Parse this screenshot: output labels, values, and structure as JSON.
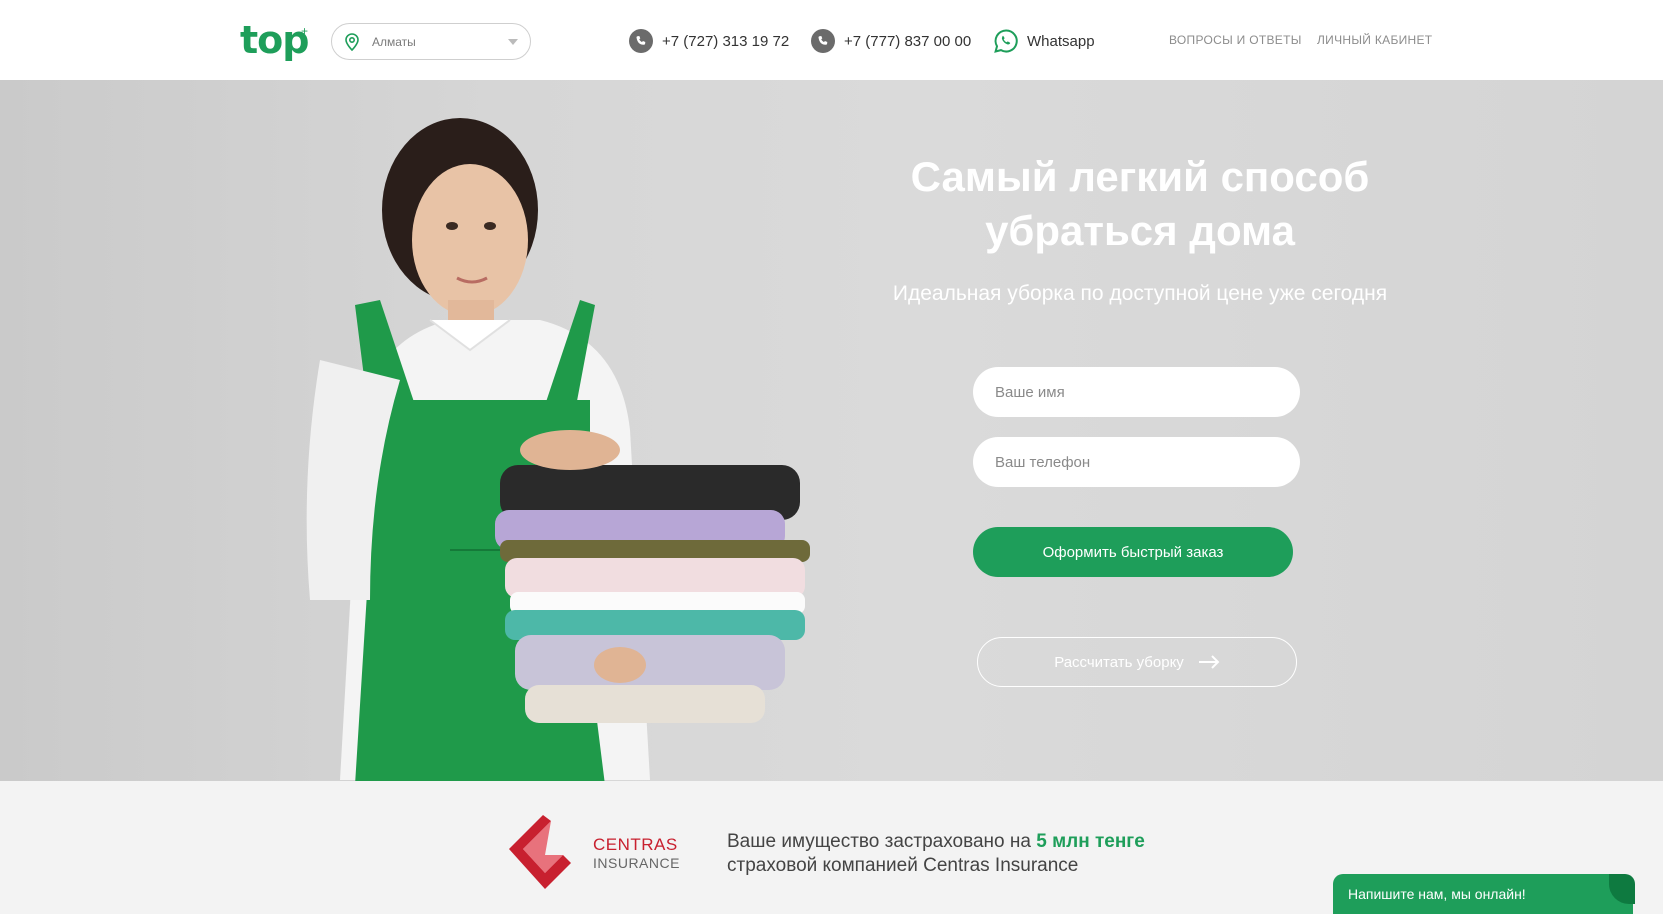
{
  "header": {
    "logo": "top",
    "city_select": {
      "value": "Алматы"
    },
    "phones": [
      "+7 (727) 313 19 72",
      "+7 (777) 837 00 00"
    ],
    "whatsapp_label": "Whatsapp",
    "nav": [
      "ВОПРОСЫ И ОТВЕТЫ",
      "ЛИЧНЫЙ КАБИНЕТ"
    ]
  },
  "hero": {
    "title_line1": "Самый легкий способ",
    "title_line2": "убраться дома",
    "subtitle": "Идеальная уборка по доступной цене уже сегодня",
    "name_placeholder": "Ваше имя",
    "phone_placeholder": "Ваш телефон",
    "order_button": "Оформить быстрый заказ",
    "calc_button": "Рассчитать уборку"
  },
  "insurance": {
    "brand_name": "CENTRAS",
    "brand_sub": "INSURANCE",
    "line1_prefix": "Ваше имущество застраховано на ",
    "line1_highlight": "5 млн тенге",
    "line2": "страховой компанией Centras Insurance"
  },
  "chat": {
    "label": "Напишите нам, мы онлайн!"
  },
  "colors": {
    "brand_green": "#1e9e5a",
    "centras_red": "#c8202f"
  },
  "icons": [
    "map-pin-icon",
    "chevron-down-icon",
    "phone-icon",
    "whatsapp-icon",
    "arrow-right-icon",
    "centras-logo-icon"
  ]
}
